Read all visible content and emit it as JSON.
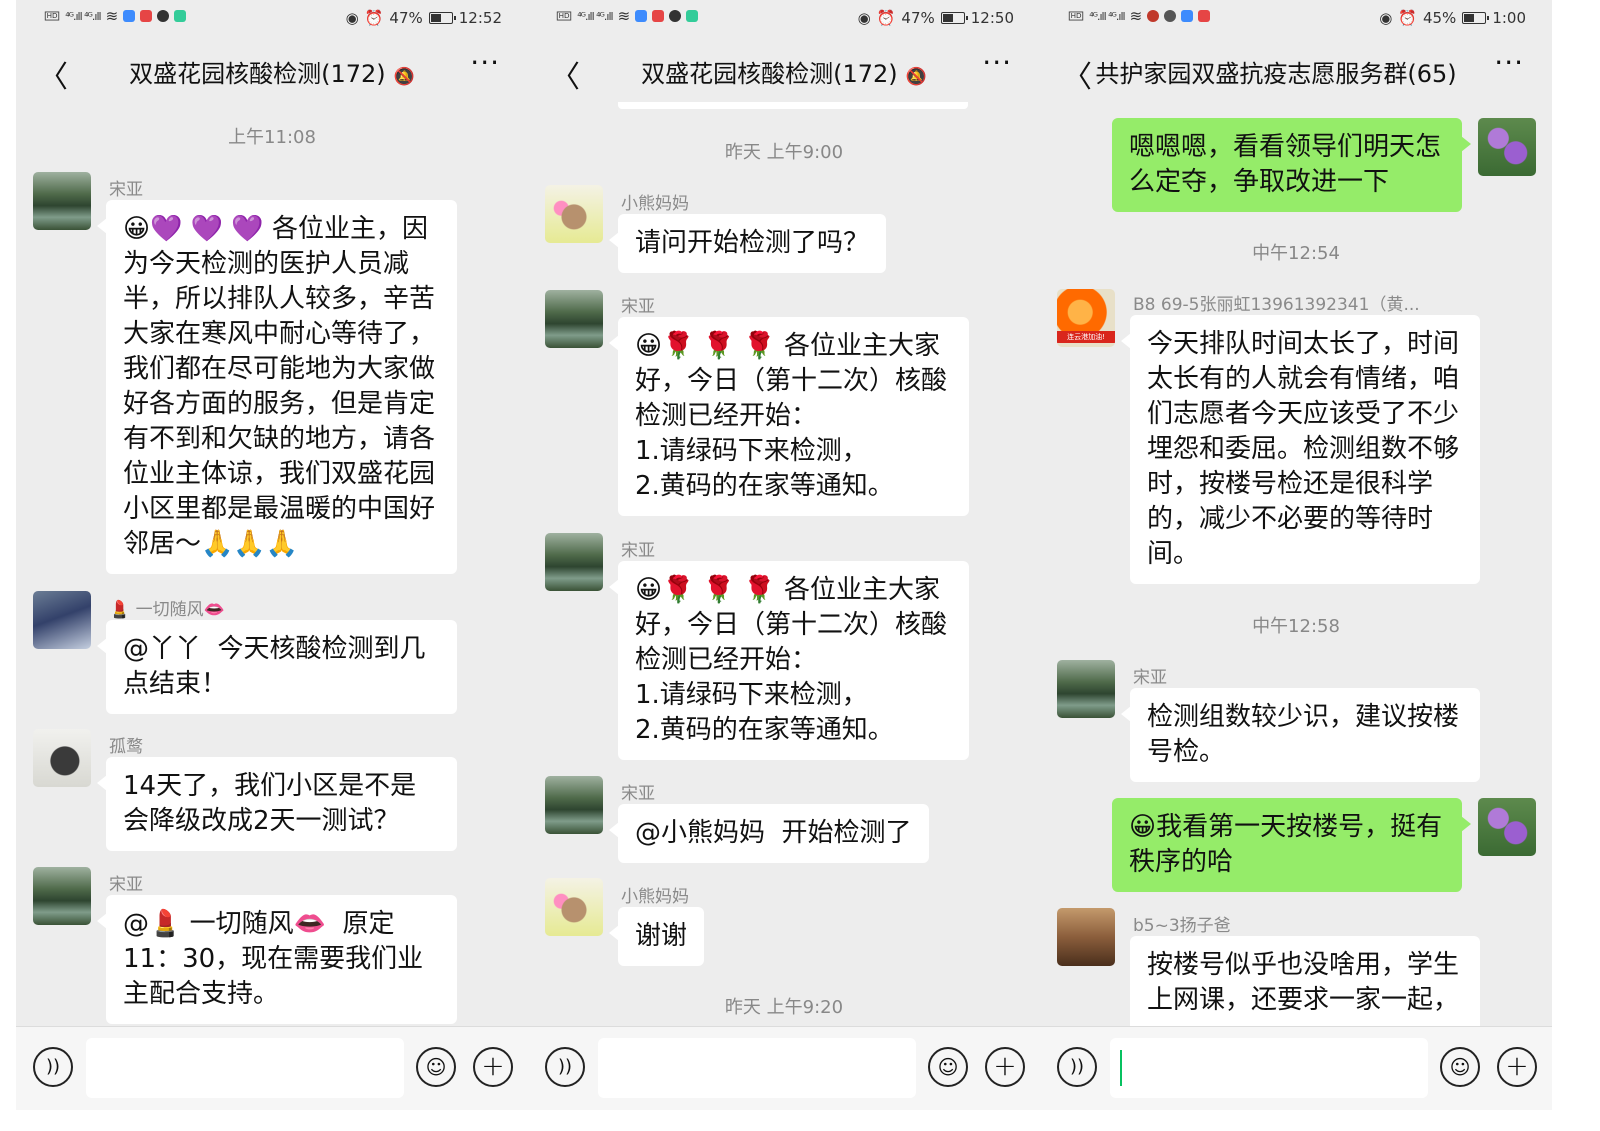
{
  "panels": [
    {
      "status": {
        "battery": "47%",
        "time": "12:52",
        "battery_level": 0.47
      },
      "header": {
        "back": "〈",
        "title": "双盛花园核酸检测(172)",
        "mute": "🔕",
        "more": "···"
      },
      "messages": [
        {
          "time": "上午11:08"
        },
        {
          "sender": "宋亚",
          "text": "😀💜 💜 💜 各位业主，因为今天检测的医护人员减半，所以排队人较多，辛苦大家在寒风中耐心等待了，我们都在尽可能地为大家做好各方面的服务，但是肯定有不到和欠缺的地方，请各位业主体谅，我们双盛花园小区里都是最温暖的中国好邻居～🙏🙏🙏"
        },
        {
          "sender": "💄 一切随风👄",
          "text": "@丫丫  今天核酸检测到几点结束！"
        },
        {
          "sender": "孤鹜",
          "text": "14天了，我们小区是不是会降级改成2天一测试？"
        },
        {
          "sender": "宋亚",
          "text": "@💄 一切随风👄  原定11：30，现在需要我们业主配合支持。"
        }
      ]
    },
    {
      "status": {
        "battery": "47%",
        "time": "12:50",
        "battery_level": 0.47
      },
      "header": {
        "back": "〈",
        "title": "双盛花园核酸检测(172)",
        "mute": "🔕",
        "more": "···"
      },
      "messages": [
        {
          "time": "昨天 上午9:00"
        },
        {
          "sender": "小熊妈妈",
          "text": "请问开始检测了吗？"
        },
        {
          "sender": "宋亚",
          "text": "😀🌹 🌹 🌹 各位业主大家好，今日（第十二次）核酸检测已经开始：\n1.请绿码下来检测，\n2.黄码的在家等通知。"
        },
        {
          "sender": "宋亚",
          "text": "😀🌹 🌹 🌹 各位业主大家好，今日（第十二次）核酸检测已经开始：\n1.请绿码下来检测，\n2.黄码的在家等通知。"
        },
        {
          "sender": "宋亚",
          "text": "@小熊妈妈  开始检测了"
        },
        {
          "sender": "小熊妈妈",
          "text": "谢谢"
        },
        {
          "time": "昨天 上午9:20"
        }
      ]
    },
    {
      "status": {
        "battery": "45%",
        "time": "1:00",
        "battery_level": 0.45
      },
      "header": {
        "back": "〈",
        "title": "共护家园双盛抗疫志愿服务群(65)",
        "mute": "",
        "more": "···"
      },
      "messages": [
        {
          "self": true,
          "text": "嗯嗯嗯，看看领导们明天怎么定夺，争取改进一下"
        },
        {
          "time": "中午12:54"
        },
        {
          "sender": "B8 69-5张丽虹13961392341（黄...",
          "avatar_tag": "连云港加油!",
          "text": "今天排队时间太长了，时间太长有的人就会有情绪，咱们志愿者今天应该受了不少埋怨和委屈。检测组数不够时，按楼号检还是很科学的，减少不必要的等待时间。"
        },
        {
          "time": "中午12:58"
        },
        {
          "sender": "宋亚",
          "text": "检测组数较少识，建议按楼号检。"
        },
        {
          "self": true,
          "text": "😀我看第一天按楼号，挺有秩序的哈"
        },
        {
          "sender": "b5~3扬子爸",
          "text": "按楼号似乎也没啥用，学生上网课，还要求一家一起，"
        }
      ]
    }
  ],
  "colors": {
    "background": "#ededed",
    "self_bubble": "#95ec69",
    "other_bubble": "#ffffff",
    "timestamp": "#888888",
    "sender": "#8a8a8a"
  },
  "icons": [
    "back-chevron-icon",
    "mute-bell-icon",
    "more-dots-icon",
    "voice-icon",
    "emoji-icon",
    "plus-icon",
    "wifi-icon",
    "signal-icon",
    "eye-icon",
    "alarm-icon",
    "battery-icon"
  ]
}
